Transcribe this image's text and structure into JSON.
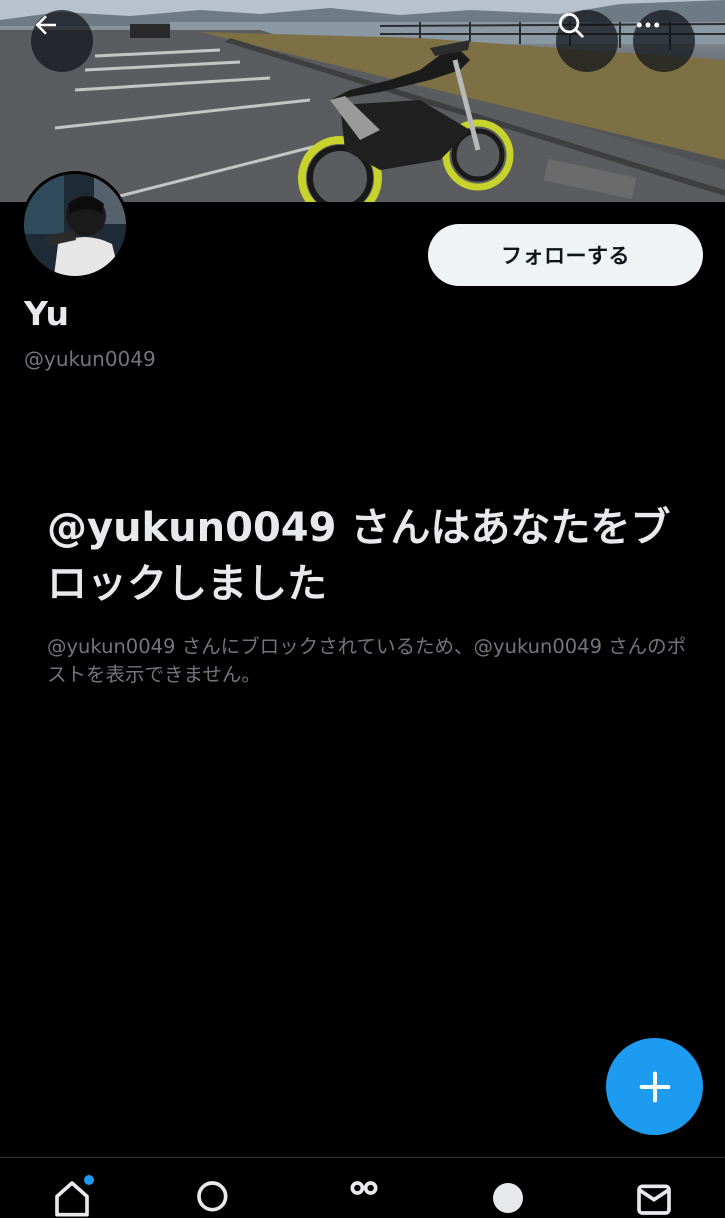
{
  "profile": {
    "display_name": "Yu",
    "handle": "@yukun0049"
  },
  "header": {
    "back_icon": "arrow-left-icon",
    "search_icon": "search-icon",
    "more_icon": "more-horizontal-icon"
  },
  "actions": {
    "follow_label": "フォローする"
  },
  "blocked_notice": {
    "title": "@yukun0049 さんはあなたをブロックしました",
    "description": "@yukun0049 さんにブロックされているため、@yukun0049 さんのポストを表示できません。"
  },
  "fab": {
    "icon": "plus-icon"
  },
  "bottom_nav": {
    "items": [
      {
        "icon": "home-icon",
        "has_notification_dot": true
      },
      {
        "icon": "search-icon"
      },
      {
        "icon": "grok-icon"
      },
      {
        "icon": "communities-icon"
      },
      {
        "icon": "messages-icon"
      }
    ]
  },
  "colors": {
    "background": "#000000",
    "accent": "#1d9bf0",
    "text_primary": "#e7e9ea",
    "text_secondary": "#71767b",
    "follow_button_bg": "#eff3f4"
  }
}
